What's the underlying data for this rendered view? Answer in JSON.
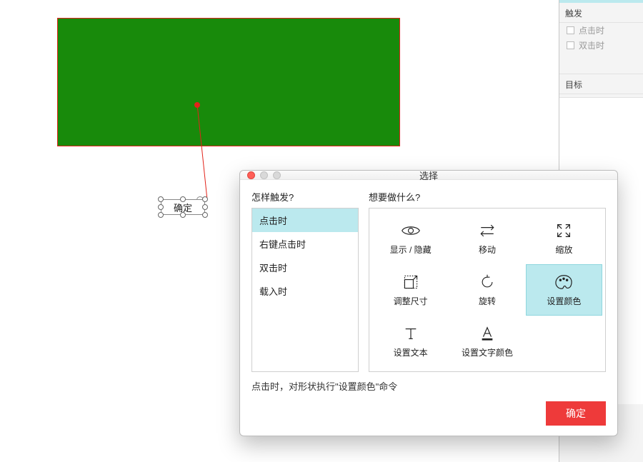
{
  "canvas": {
    "shape_button_label": "确定"
  },
  "side": {
    "trigger_title": "触发",
    "on_click": "点击时",
    "on_dblclick": "双击时",
    "target_title": "目标"
  },
  "dialog": {
    "title": "选择",
    "trigger_question": "怎样触发?",
    "action_question": "想要做什么?",
    "triggers": {
      "click": "点击时",
      "rightclick": "右键点击时",
      "dblclick": "双击时",
      "load": "载入时"
    },
    "actions": {
      "show_hide": "显示 / 隐藏",
      "move": "移动",
      "scale": "缩放",
      "resize": "调整尺寸",
      "rotate": "旋转",
      "set_color": "设置颜色",
      "set_text": "设置文本",
      "set_text_color": "设置文字颜色"
    },
    "summary": "点击时，对形状执行\"设置颜色\"命令",
    "ok": "确定"
  }
}
